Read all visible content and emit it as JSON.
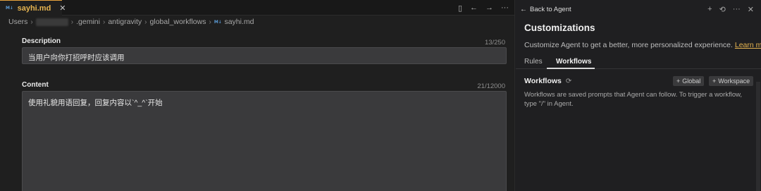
{
  "editor": {
    "tab": {
      "icon_text": "M↓",
      "label": "sayhi.md",
      "close": "✕"
    },
    "tab_actions": [
      "▯",
      "←",
      "→",
      "···"
    ],
    "breadcrumb": {
      "items": [
        "Users",
        ".gemini",
        "antigravity",
        "global_workflows",
        "sayhi.md"
      ],
      "file_icon_text": "M↓"
    },
    "description": {
      "label": "Description",
      "count": "13/250",
      "value": "当用户向你打招呼时应该调用"
    },
    "content": {
      "label": "Content",
      "count": "21/12000",
      "value": "使用礼貌用语回复，回复内容以`^_^`开始"
    }
  },
  "panel": {
    "back_label": "Back to Agent",
    "actions": [
      "+",
      "⟲",
      "···",
      "✕"
    ],
    "title": "Customizations",
    "subtitle": "Customize Agent to get a better, more personalized experience.",
    "learn_more": "Learn more.",
    "tabs": [
      "Rules",
      "Workflows"
    ],
    "active_tab": "Workflows",
    "workflows": {
      "heading": "Workflows",
      "global_button": "Global",
      "workspace_button": "Workspace",
      "description": "Workflows are saved prompts that Agent can follow. To trigger a workflow, type \"/\" in Agent."
    }
  },
  "colors": {
    "accent": "#e6b450",
    "background": "#1f1f1f",
    "input_bg": "#3a3a3c"
  }
}
